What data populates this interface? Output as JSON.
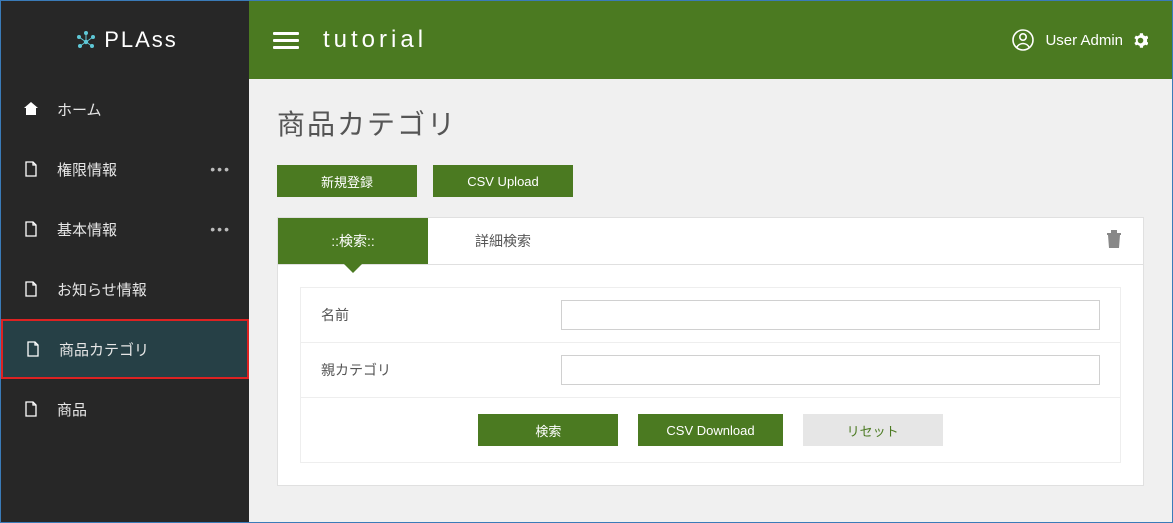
{
  "logo_text": "PLAss",
  "topbar": {
    "title": "tutorial",
    "user_name": "User Admin"
  },
  "sidebar": {
    "items": [
      {
        "label": "ホーム",
        "icon": "home",
        "more": false,
        "active": false
      },
      {
        "label": "権限情報",
        "icon": "file",
        "more": true,
        "active": false
      },
      {
        "label": "基本情報",
        "icon": "file",
        "more": true,
        "active": false
      },
      {
        "label": "お知らせ情報",
        "icon": "file",
        "more": false,
        "active": false
      },
      {
        "label": "商品カテゴリ",
        "icon": "file",
        "more": false,
        "active": true
      },
      {
        "label": "商品",
        "icon": "file",
        "more": false,
        "active": false
      }
    ]
  },
  "page": {
    "title": "商品カテゴリ",
    "actions": {
      "new_label": "新規登録",
      "csv_upload_label": "CSV Upload"
    },
    "tabs": {
      "search_label": "::検索::",
      "detail_label": "詳細検索"
    },
    "form": {
      "name_label": "名前",
      "name_value": "",
      "parent_label": "親カテゴリ",
      "parent_value": ""
    },
    "buttons": {
      "search_label": "検索",
      "csv_download_label": "CSV Download",
      "reset_label": "リセット"
    }
  }
}
